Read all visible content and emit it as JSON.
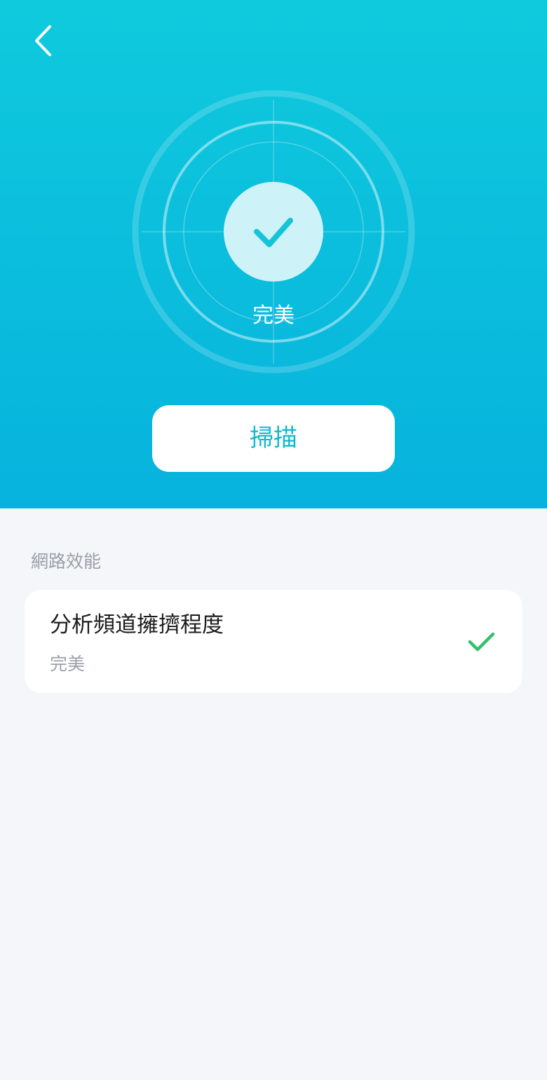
{
  "header": {
    "back_icon": "chevron-left-icon"
  },
  "status": {
    "icon": "checkmark-icon",
    "label": "完美"
  },
  "scan_button_label": "掃描",
  "section": {
    "title": "網路效能",
    "items": [
      {
        "title": "分析頻道擁擠程度",
        "subtitle": "完美",
        "status_icon": "checkmark-icon"
      }
    ]
  },
  "colors": {
    "gradient_top": "#0fcadd",
    "gradient_bottom": "#07b3dd",
    "accent": "#10b8cf",
    "check_green": "#34c06b",
    "background": "#f4f6fa"
  }
}
